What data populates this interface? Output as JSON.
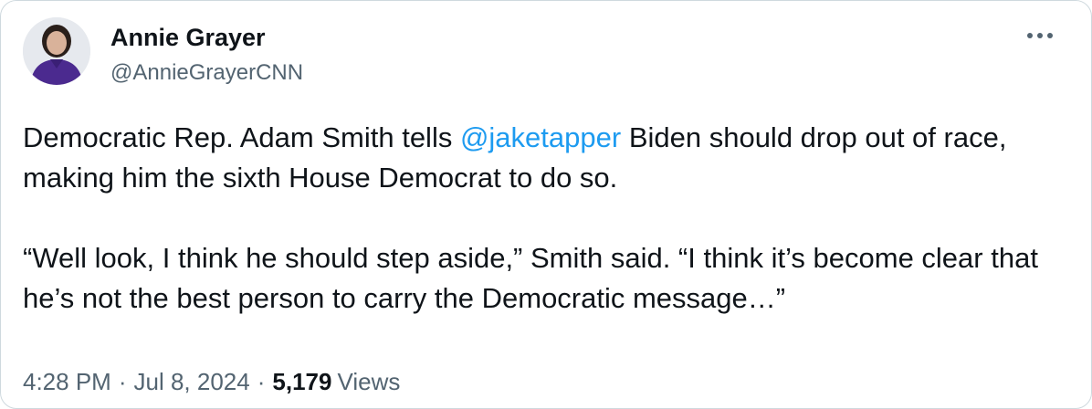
{
  "author": {
    "display_name": "Annie Grayer",
    "handle": "@AnnieGrayerCNN",
    "avatar_icon": "profile-photo"
  },
  "menu_icon": "more-horizontal-icon",
  "tweet": {
    "line1_before": "Democratic Rep. Adam Smith tells ",
    "mention": "@jaketapper",
    "line1_after": " Biden should drop out of race, making him the sixth House Democrat to do so.",
    "paragraph2": "“Well look, I think he should step aside,” Smith said. “I think it’s become clear that he’s not the best person to carry the Democratic message…”"
  },
  "meta": {
    "time": "4:28 PM",
    "separator": "·",
    "date": "Jul 8, 2024",
    "view_count": "5,179",
    "views_label": "Views"
  },
  "colors": {
    "link": "#1d9bf0",
    "secondary_text": "#536471",
    "primary_text": "#0f1419",
    "border": "#cfd9de"
  }
}
